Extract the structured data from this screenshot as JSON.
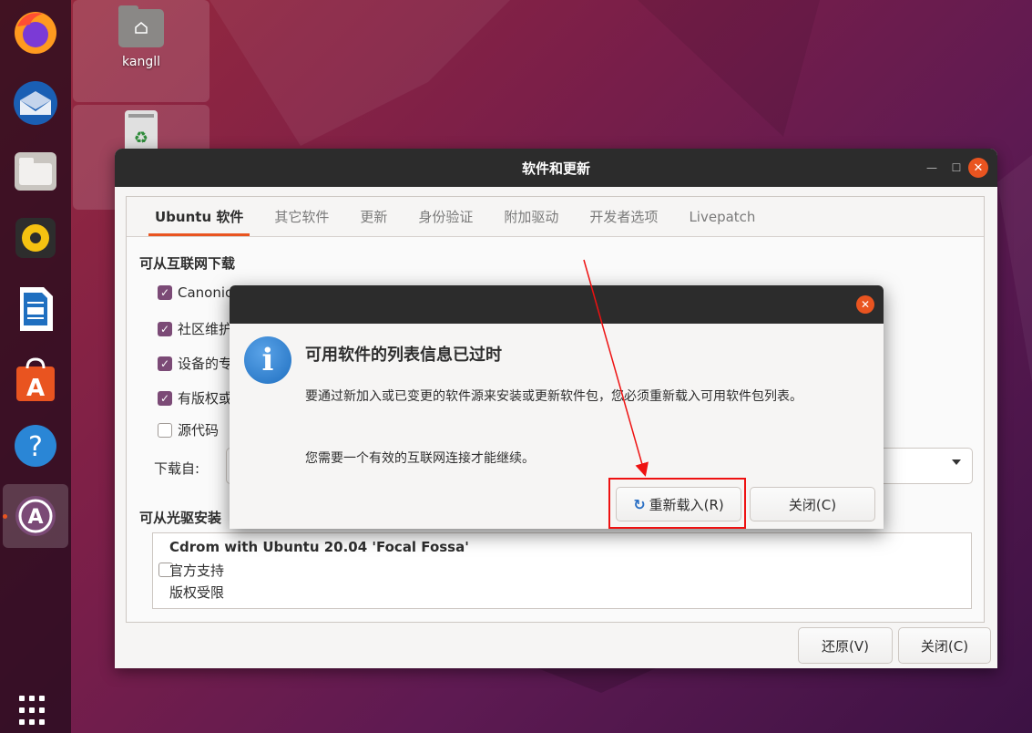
{
  "desktop": {
    "home_folder_label": "kangll",
    "home_folder_icon": "home-folder-icon",
    "trash_icon": "trash-icon"
  },
  "dock": {
    "items": [
      {
        "name": "firefox",
        "icon": "firefox-icon"
      },
      {
        "name": "thunderbird",
        "icon": "thunderbird-icon"
      },
      {
        "name": "files",
        "icon": "files-icon"
      },
      {
        "name": "rhythmbox",
        "icon": "rhythmbox-icon"
      },
      {
        "name": "libreoffice-writer",
        "icon": "writer-icon"
      },
      {
        "name": "ubuntu-software",
        "icon": "software-store-icon"
      },
      {
        "name": "help",
        "icon": "help-icon",
        "glyph": "?"
      },
      {
        "name": "software-updater",
        "icon": "software-updater-icon",
        "active": true
      }
    ],
    "show_apps_icon": "app-grid-icon"
  },
  "window": {
    "title": "软件和更新",
    "tabs": [
      "Ubuntu 软件",
      "其它软件",
      "更新",
      "身份验证",
      "附加驱动",
      "开发者选项",
      "Livepatch"
    ],
    "active_tab": 0,
    "internet_section": "可从互联网下载",
    "sources": [
      {
        "label": "Canonic",
        "checked": true
      },
      {
        "label": "社区维护",
        "checked": true
      },
      {
        "label": "设备的专",
        "checked": true
      },
      {
        "label": "有版权或",
        "checked": true
      },
      {
        "label": "源代码",
        "checked": false
      }
    ],
    "download_from_label": "下载自:",
    "cdrom_section": "可从光驱安装",
    "cdrom": {
      "title": "Cdrom with Ubuntu 20.04 'Focal Fossa'",
      "line1": "官方支持",
      "line2": "版权受限",
      "checked": false
    },
    "revert_button": "还原(V)",
    "close_button": "关闭(C)"
  },
  "dialog": {
    "heading": "可用软件的列表信息已过时",
    "message": "要通过新加入或已变更的软件源来安装或更新软件包，您必须重新载入可用软件包列表。",
    "note": "您需要一个有效的互联网连接才能继续。",
    "icon": "info-icon",
    "reload_button": "重新载入(R)",
    "close_button": "关闭(C)"
  },
  "colors": {
    "accent": "#e95420",
    "check": "#7b4a76",
    "annotation": "#e11111",
    "titlebar": "#2c2c2c"
  }
}
